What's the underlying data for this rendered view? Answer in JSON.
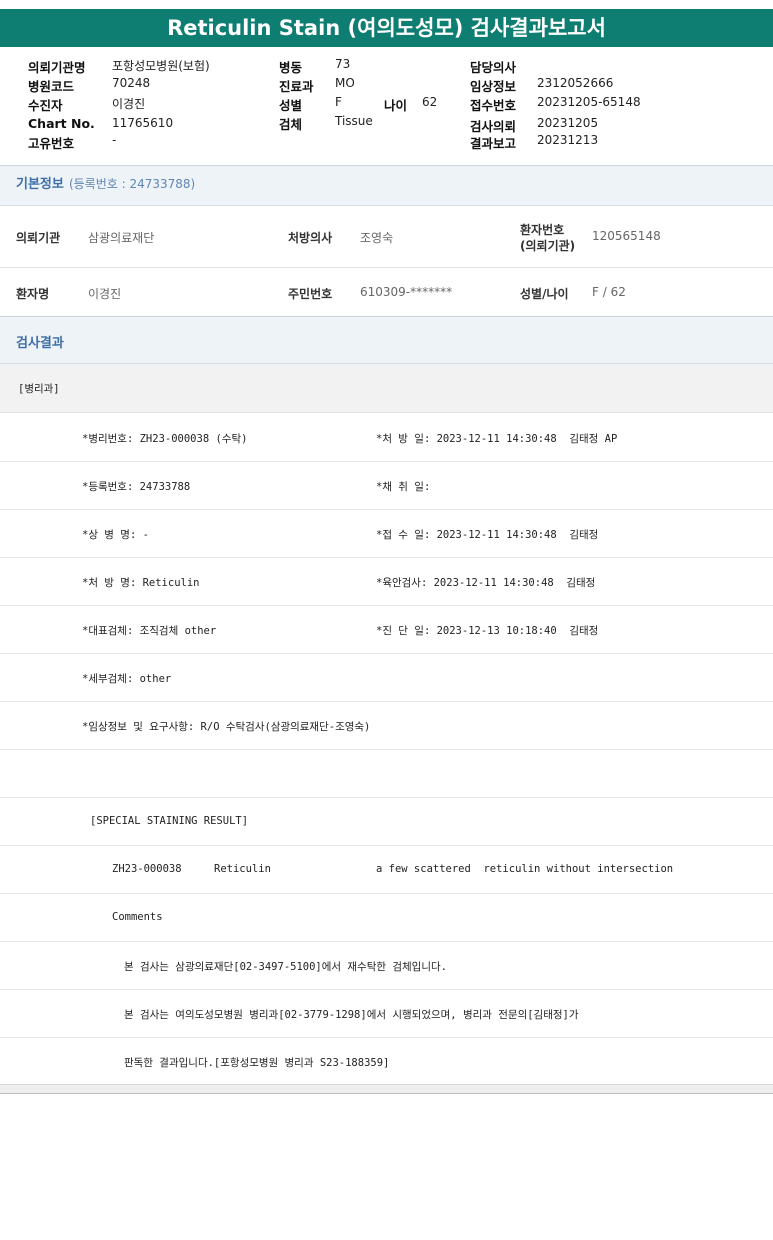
{
  "report": {
    "title": "Reticulin Stain (여의도성모) 검사결과보고서"
  },
  "header": {
    "hospital_label": "의뢰기관명",
    "hospital": "포항성모병원(보험)",
    "code_label": "병원코드",
    "code": "70248",
    "recipient_label": "수진자",
    "recipient": "이경진",
    "chart_label": "Chart No.",
    "chart": "11765610",
    "unique_label": "고유번호",
    "unique": "-",
    "ward_label": "병동",
    "ward": "73",
    "dept_label": "진료과",
    "dept": "MO",
    "sex_label": "성별",
    "sex": "F",
    "age_label": "나이",
    "age": "62",
    "specimen_label": "검체",
    "specimen": "Tissue",
    "doctor_label": "담당의사",
    "doctor": "",
    "clinical_label": "임상정보",
    "clinical": "2312052666",
    "accession_label": "접수번호",
    "accession": "20231205-65148",
    "request_label": "검사의뢰",
    "request": "20231205",
    "result_label": "결과보고",
    "result": "20231213"
  },
  "basic": {
    "title": "기본정보",
    "reg_text": "(등록번호 : 24733788)",
    "requester_label": "의뢰기관",
    "requester": "삼광의료재단",
    "prescriber_label": "처방의사",
    "prescriber": "조영숙",
    "patient_no_label1": "환자번호",
    "patient_no_label2": "(의뢰기관)",
    "patient_no": "120565148",
    "patient_label": "환자명",
    "patient": "이경진",
    "rrn_label": "주민번호",
    "rrn": "610309-*******",
    "sexage_label": "성별/나이",
    "sexage": "F / 62"
  },
  "results": {
    "title": "검사결과",
    "dept": "[병리과]",
    "lines": {
      "l1a": "*병리번호: ZH23-000038 (수탁)",
      "l1b": "*처 방 일: 2023-12-11 14:30:48  김태정 AP",
      "l2a": "*등록번호: 24733788",
      "l2b": "*채 취 일:",
      "l3a": "*상 병 명: -",
      "l3b": "*접 수 일: 2023-12-11 14:30:48  김태정",
      "l4a": "*처 방 명: Reticulin",
      "l4b": "*육안검사: 2023-12-11 14:30:48  김태정",
      "l5a": "*대표검체: 조직검체 other",
      "l5b": "*진 단 일: 2023-12-13 10:18:40  김태정",
      "l6a": "*세부검체: other",
      "l7a": "*임상정보 및 요구사항: R/O 수탁검사(삼광의료재단-조영숙)",
      "special": "[SPECIAL STAINING RESULT]",
      "res_id": "ZH23-000038",
      "res_stain": "Reticulin",
      "res_text": "a few scattered  reticulin without intersection",
      "comments": "Comments",
      "c1": "본 검사는 삼광의료재단[02-3497-5100]에서 재수탁한 검체입니다.",
      "c2": "본 검사는 여의도성모병원 병리과[02-3779-1298]에서 시행되었으며, 병리과 전문의[김태정]가",
      "c3": "판독한 결과입니다.[포항성모병원 병리과 S23-188359]"
    }
  },
  "colors": {
    "title_bg": "#0e7d72",
    "section_text": "#3f6fa8",
    "band_bg": "#eef3f7"
  }
}
